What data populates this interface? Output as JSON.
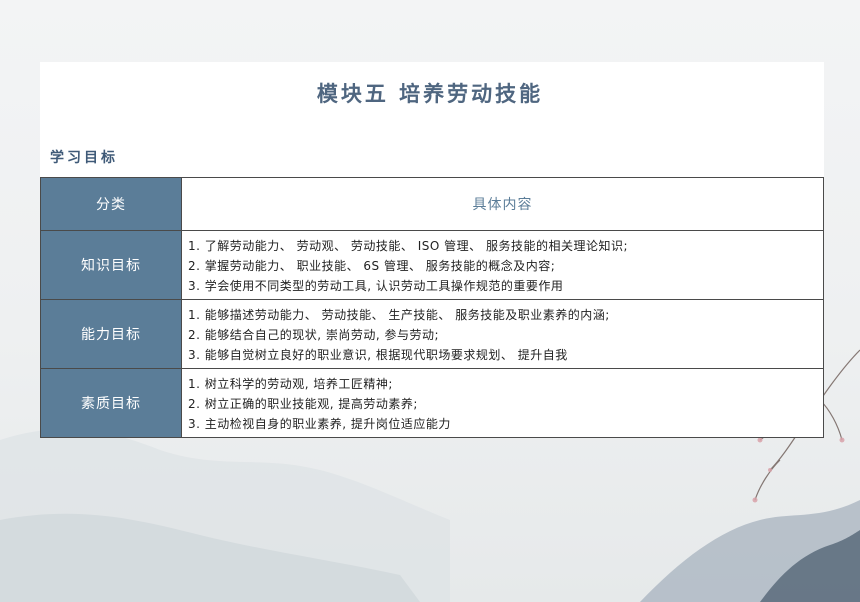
{
  "title": "模块五 培养劳动技能",
  "section_heading": "学习目标",
  "table": {
    "header": {
      "category": "分类",
      "content": "具体内容"
    },
    "rows": [
      {
        "category": "知识目标",
        "items": [
          "1. 了解劳动能力、 劳动观、 劳动技能、 ISO 管理、 服务技能的相关理论知识;",
          "2. 掌握劳动能力、 职业技能、 6S 管理、 服务技能的概念及内容;",
          "3. 学会使用不同类型的劳动工具, 认识劳动工具操作规范的重要作用"
        ]
      },
      {
        "category": "能力目标",
        "items": [
          "1. 能够描述劳动能力、 劳动技能、 生产技能、 服务技能及职业素养的内涵;",
          "2. 能够结合自己的现状, 崇尚劳动, 参与劳动;",
          "3. 能够自觉树立良好的职业意识, 根据现代职场要求规划、 提升自我"
        ]
      },
      {
        "category": "素质目标",
        "items": [
          "1. 树立科学的劳动观, 培养工匠精神;",
          "2. 树立正确的职业技能观, 提高劳动素养;",
          "3. 主动检视自身的职业素养, 提升岗位适应能力"
        ]
      }
    ]
  },
  "colors": {
    "title": "#4f6680",
    "category_bg": "#5b7d98",
    "header_text": "#5b7d98",
    "body_text": "#222222"
  }
}
